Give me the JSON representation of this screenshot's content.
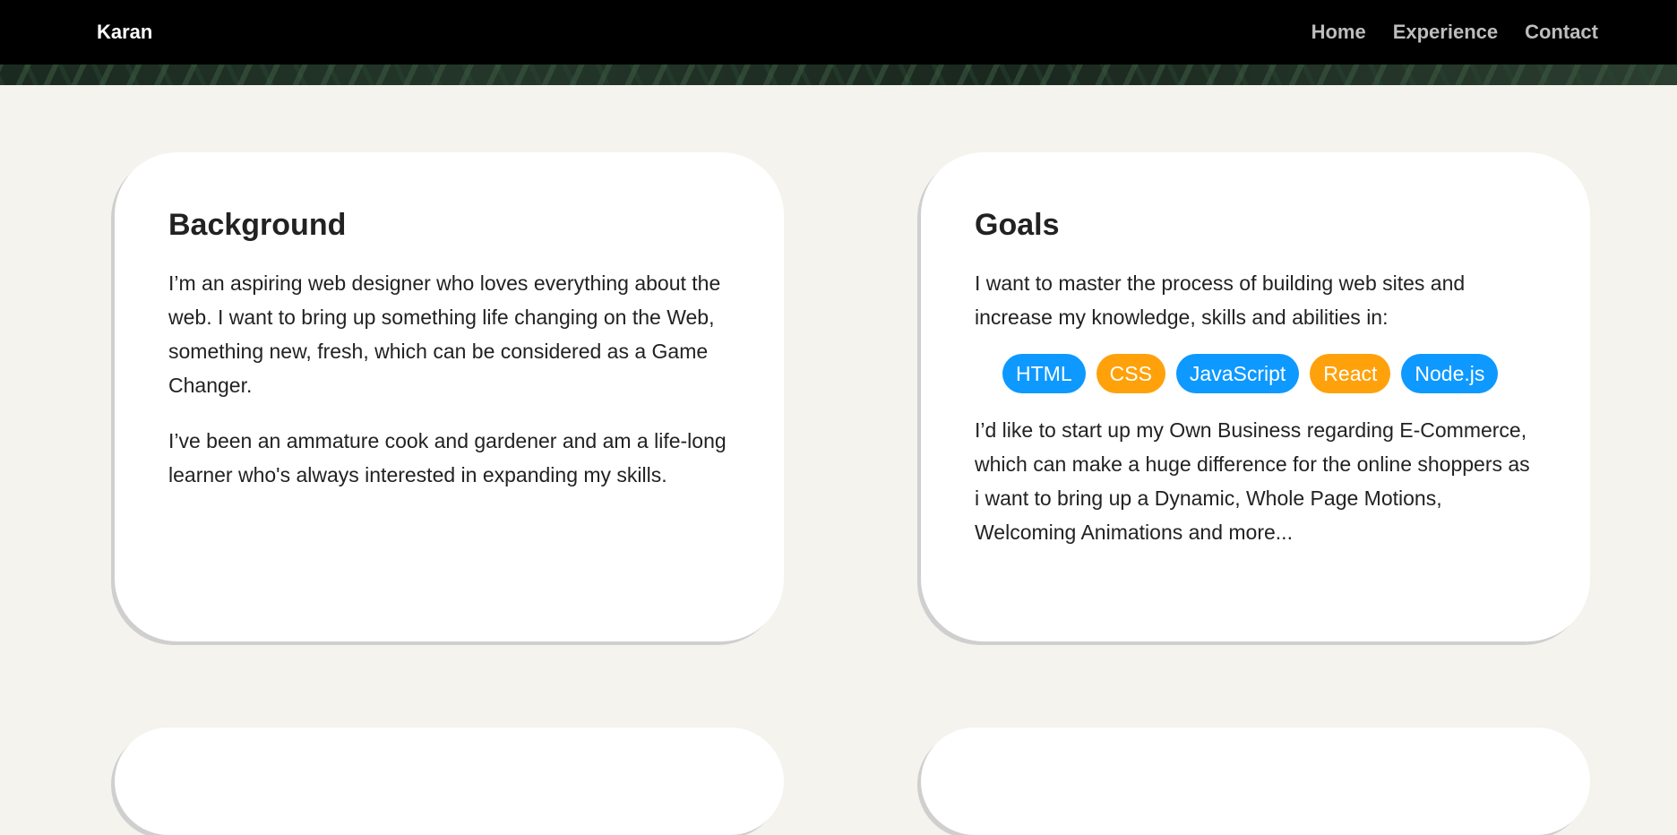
{
  "nav": {
    "brand": "Karan",
    "links": [
      "Home",
      "Experience",
      "Contact"
    ]
  },
  "background_card": {
    "title": "Background",
    "paragraphs": [
      "I’m an aspiring web designer who loves everything about the web. I want to bring up something life changing on the Web, something new, fresh, which can be considered as a Game Changer.",
      "I’ve been an ammature cook and gardener and am a life-long learner who's always interested in expanding my skills."
    ]
  },
  "goals_card": {
    "title": "Goals",
    "intro": "I want to master the process of building web sites and increase my knowledge, skills and abilities in:",
    "tags": [
      {
        "label": "HTML",
        "color": "#0d99ff"
      },
      {
        "label": "CSS",
        "color": "#ffa10a"
      },
      {
        "label": "JavaScript",
        "color": "#0d99ff"
      },
      {
        "label": "React",
        "color": "#ffa10a"
      },
      {
        "label": "Node.js",
        "color": "#0d99ff"
      }
    ],
    "outro": "I’d like to start up my Own Business regarding E-Commerce, which can make a huge difference for the online shoppers as i want to bring up a Dynamic, Whole Page Motions, Welcoming Animations and more..."
  },
  "colors": {
    "page_bg": "#f4f3ee",
    "nav_bg": "#000000",
    "tag_blue": "#0d99ff",
    "tag_orange": "#ffa10a"
  }
}
